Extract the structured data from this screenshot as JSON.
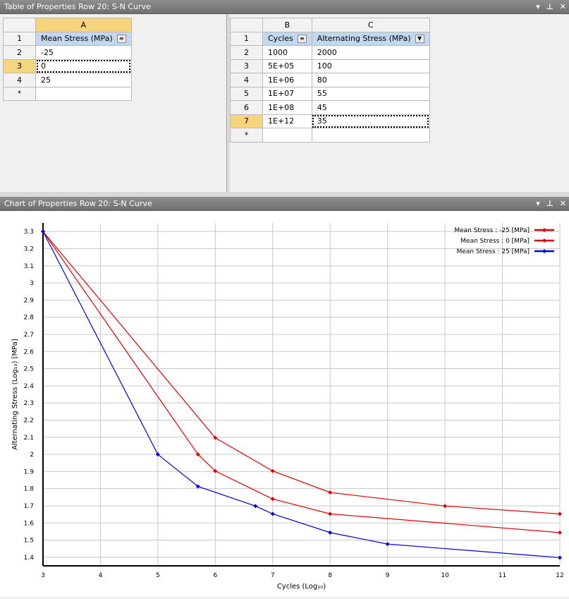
{
  "table_pane": {
    "title": "Table of Properties Row 20: S-N Curve",
    "controls": [
      "▾",
      "⊥",
      "✕"
    ]
  },
  "table_left": {
    "col_header": "A",
    "rows": [
      {
        "row": "1",
        "value": "Mean Stress (MPa)"
      },
      {
        "row": "2",
        "value": "-25"
      },
      {
        "row": "3",
        "value": "0"
      },
      {
        "row": "4",
        "value": "25"
      },
      {
        "row": "*",
        "value": ""
      }
    ]
  },
  "table_right": {
    "col_headers": [
      "B",
      "C"
    ],
    "rows": [
      {
        "row": "1",
        "b": "Cycles",
        "c": "Alternating Stress (MPa)"
      },
      {
        "row": "2",
        "b": "1000",
        "c": "2000"
      },
      {
        "row": "3",
        "b": "5E+05",
        "c": "100"
      },
      {
        "row": "4",
        "b": "1E+06",
        "c": "80"
      },
      {
        "row": "5",
        "b": "1E+07",
        "c": "55"
      },
      {
        "row": "6",
        "b": "1E+08",
        "c": "45"
      },
      {
        "row": "7",
        "b": "1E+12",
        "c": "35"
      },
      {
        "row": "*",
        "b": "",
        "c": ""
      }
    ]
  },
  "chart_pane": {
    "title": "Chart of Properties Row 20: S-N Curve",
    "controls": [
      "▾",
      "⊥",
      "✕"
    ]
  },
  "chart_data": {
    "type": "line",
    "xlabel": "Cycles  (Log₁₀)",
    "ylabel": "Alternating Stress  (Log₁₀)  [MPa]",
    "xlim": [
      3,
      12
    ],
    "ylim": [
      1.35,
      3.35
    ],
    "xticks": [
      3,
      4,
      5,
      6,
      7,
      8,
      9,
      10,
      11,
      12
    ],
    "yticks": [
      1.4,
      1.5,
      1.6,
      1.7,
      1.8,
      1.9,
      2.0,
      2.1,
      2.2,
      2.3,
      2.4,
      2.5,
      2.6,
      2.7,
      2.8,
      2.9,
      3.0,
      3.1,
      3.2,
      3.3
    ],
    "ytick_labels": [
      "1.4",
      "1.5",
      "1.6",
      "1.7",
      "1.8",
      "1.9",
      "2",
      "2.1",
      "2.2",
      "2.3",
      "2.4",
      "2.5",
      "2.6",
      "2.7",
      "2.8",
      "2.9",
      "3",
      "3.1",
      "3.2",
      "3.3"
    ],
    "grid": true,
    "legend_position": "top-right",
    "series": [
      {
        "name": "Mean Stress : -25 [MPa]",
        "color": "#e00000",
        "x": [
          3,
          6,
          7,
          8,
          10,
          12
        ],
        "y": [
          3.3,
          2.097,
          1.903,
          1.778,
          1.699,
          1.653
        ]
      },
      {
        "name": "Mean Stress : 0 [MPa]",
        "color": "#e00000",
        "x": [
          3,
          5.699,
          6,
          7,
          8,
          12
        ],
        "y": [
          3.301,
          2.0,
          1.903,
          1.74,
          1.653,
          1.544
        ]
      },
      {
        "name": "Mean Stress : 25 [MPa]",
        "color": "#0000dd",
        "x": [
          3,
          5,
          5.699,
          6.699,
          7,
          8,
          9,
          12
        ],
        "y": [
          3.3,
          2.0,
          1.813,
          1.699,
          1.653,
          1.544,
          1.477,
          1.398
        ]
      }
    ]
  }
}
